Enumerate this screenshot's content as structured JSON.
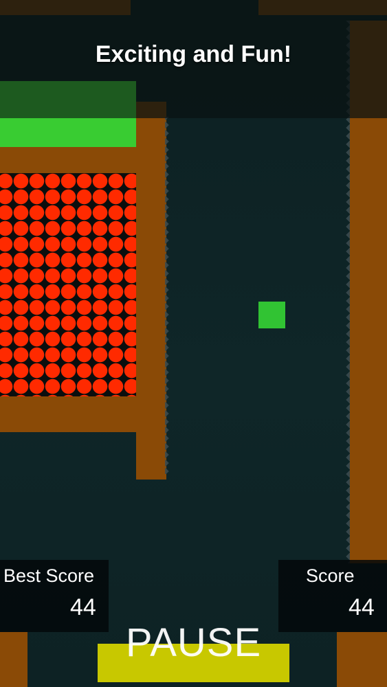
{
  "banner": {
    "text": "Exciting and Fun!"
  },
  "hud": {
    "best_score_label": "Best Score",
    "best_score_value": "44",
    "score_label": "Score",
    "score_value": "44",
    "pause_label": "PAUSE"
  },
  "colors": {
    "wall": "#8a4a06",
    "balls": "#ff2a00",
    "player": "#31c333",
    "pause_button": "#c8c800",
    "progress_bar": "#39cc32"
  }
}
